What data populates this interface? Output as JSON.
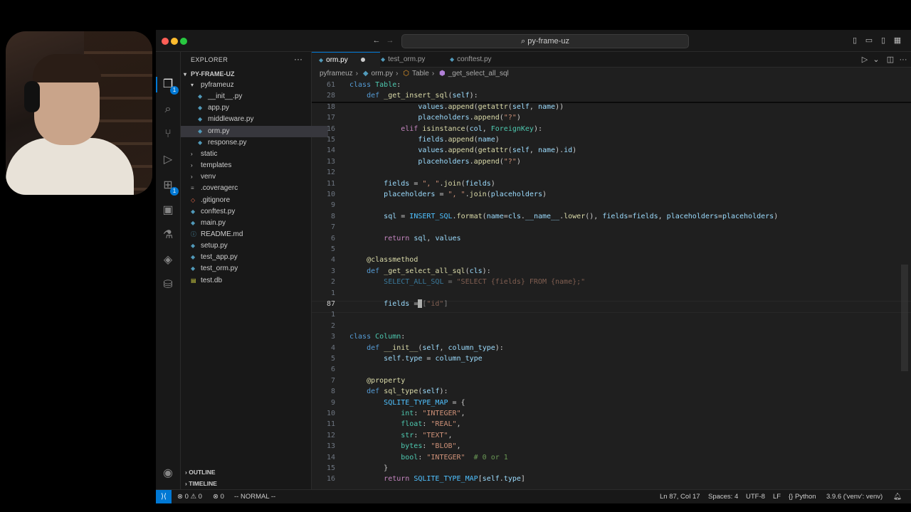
{
  "window": {
    "title": "py-frame-uz"
  },
  "sidebar": {
    "title": "EXPLORER",
    "root": "PY-FRAME-UZ",
    "items": [
      {
        "label": "pyframeuz",
        "kind": "folder-open",
        "depth": 1
      },
      {
        "label": "__init__.py",
        "kind": "py",
        "depth": 2
      },
      {
        "label": "app.py",
        "kind": "py",
        "depth": 2
      },
      {
        "label": "middleware.py",
        "kind": "py",
        "depth": 2
      },
      {
        "label": "orm.py",
        "kind": "py",
        "depth": 2,
        "selected": true
      },
      {
        "label": "response.py",
        "kind": "py",
        "depth": 2
      },
      {
        "label": "static",
        "kind": "folder",
        "depth": 1
      },
      {
        "label": "templates",
        "kind": "folder",
        "depth": 1
      },
      {
        "label": "venv",
        "kind": "folder",
        "depth": 1
      },
      {
        "label": ".coveragerc",
        "kind": "file",
        "depth": 1
      },
      {
        "label": ".gitignore",
        "kind": "git",
        "depth": 1
      },
      {
        "label": "conftest.py",
        "kind": "py",
        "depth": 1
      },
      {
        "label": "main.py",
        "kind": "py",
        "depth": 1
      },
      {
        "label": "README.md",
        "kind": "md",
        "depth": 1
      },
      {
        "label": "setup.py",
        "kind": "py",
        "depth": 1
      },
      {
        "label": "test_app.py",
        "kind": "py",
        "depth": 1
      },
      {
        "label": "test_orm.py",
        "kind": "py",
        "depth": 1
      },
      {
        "label": "test.db",
        "kind": "db",
        "depth": 1
      }
    ],
    "outline": "OUTLINE",
    "timeline": "TIMELINE"
  },
  "tabs": [
    {
      "label": "orm.py",
      "active": true,
      "dirty": true
    },
    {
      "label": "test_orm.py",
      "active": false
    },
    {
      "label": "conftest.py",
      "active": false
    }
  ],
  "breadcrumb": [
    "pyframeuz",
    "orm.py",
    "Table",
    "_get_select_all_sql"
  ],
  "editor": {
    "lines": [
      {
        "n": "61",
        "html": "<span class='kw'>class</span> <span class='cls'>Table</span>:"
      },
      {
        "n": "28",
        "html": "    <span class='kw'>def</span> <span class='fn'>_get_insert_sql</span>(<span class='var'>self</span>):"
      },
      {
        "n": "18",
        "html": "                <span class='var'>values</span>.<span class='fn'>append</span>(<span class='fn'>getattr</span>(<span class='var'>self</span>, <span class='var'>name</span>))"
      },
      {
        "n": "17",
        "html": "                <span class='var'>placeholders</span>.<span class='fn'>append</span>(<span class='str'>\"?\"</span>)"
      },
      {
        "n": "16",
        "html": "            <span class='kw2'>elif</span> <span class='fn'>isinstance</span>(<span class='var'>col</span>, <span class='cls'>ForeignKey</span>):"
      },
      {
        "n": "15",
        "html": "                <span class='var'>fields</span>.<span class='fn'>append</span>(<span class='var'>name</span>)"
      },
      {
        "n": "14",
        "html": "                <span class='var'>values</span>.<span class='fn'>append</span>(<span class='fn'>getattr</span>(<span class='var'>self</span>, <span class='var'>name</span>).<span class='var'>id</span>)"
      },
      {
        "n": "13",
        "html": "                <span class='var'>placeholders</span>.<span class='fn'>append</span>(<span class='str'>\"?\"</span>)"
      },
      {
        "n": "12",
        "html": ""
      },
      {
        "n": "11",
        "html": "        <span class='var'>fields</span> = <span class='str'>\", \"</span>.<span class='fn'>join</span>(<span class='var'>fields</span>)"
      },
      {
        "n": "10",
        "html": "        <span class='var'>placeholders</span> = <span class='str'>\", \"</span>.<span class='fn'>join</span>(<span class='var'>placeholders</span>)"
      },
      {
        "n": "9",
        "html": ""
      },
      {
        "n": "8",
        "html": "        <span class='var'>sql</span> = <span class='const'>INSERT_SQL</span>.<span class='fn'>format</span>(<span class='var'>name</span>=<span class='var'>cls</span>.<span class='var'>__name__</span>.<span class='fn'>lower</span>(), <span class='var'>fields</span>=<span class='var'>fields</span>, <span class='var'>placeholders</span>=<span class='var'>placeholders</span>)"
      },
      {
        "n": "7",
        "html": ""
      },
      {
        "n": "6",
        "html": "        <span class='kw2'>return</span> <span class='var'>sql</span>, <span class='var'>values</span>"
      },
      {
        "n": "5",
        "html": ""
      },
      {
        "n": "4",
        "html": "    <span class='fn'>@classmethod</span>"
      },
      {
        "n": "3",
        "html": "    <span class='kw'>def</span> <span class='fn'>_get_select_all_sql</span>(<span class='var'>cls</span>):"
      },
      {
        "n": "2",
        "html": "        <span class='dim'><span class='const'>SELECT_ALL_SQL</span> = <span class='str'>\"SELECT {fields} FROM {name};\"</span></span>"
      },
      {
        "n": "1",
        "html": ""
      },
      {
        "n": "87",
        "html": "        <span class='var'>fields</span> =<span class='cursor'></span><span class='dim'>[<span class='str'>\"id\"</span>]</span>",
        "current": true
      },
      {
        "n": "1",
        "html": ""
      },
      {
        "n": "2",
        "html": ""
      },
      {
        "n": "3",
        "html": "<span class='kw'>class</span> <span class='cls'>Column</span>:"
      },
      {
        "n": "4",
        "html": "    <span class='kw'>def</span> <span class='fn'>__init__</span>(<span class='var'>self</span>, <span class='var'>column_type</span>):"
      },
      {
        "n": "5",
        "html": "        <span class='var'>self</span>.<span class='var'>type</span> = <span class='var'>column_type</span>"
      },
      {
        "n": "6",
        "html": ""
      },
      {
        "n": "7",
        "html": "    <span class='fn'>@property</span>"
      },
      {
        "n": "8",
        "html": "    <span class='kw'>def</span> <span class='fn'>sql_type</span>(<span class='var'>self</span>):"
      },
      {
        "n": "9",
        "html": "        <span class='const'>SQLITE_TYPE_MAP</span> = {"
      },
      {
        "n": "10",
        "html": "            <span class='cls'>int</span>: <span class='str'>\"INTEGER\"</span>,"
      },
      {
        "n": "11",
        "html": "            <span class='cls'>float</span>: <span class='str'>\"REAL\"</span>,"
      },
      {
        "n": "12",
        "html": "            <span class='cls'>str</span>: <span class='str'>\"TEXT\"</span>,"
      },
      {
        "n": "13",
        "html": "            <span class='cls'>bytes</span>: <span class='str'>\"BLOB\"</span>,"
      },
      {
        "n": "14",
        "html": "            <span class='cls'>bool</span>: <span class='str'>\"INTEGER\"</span>  <span class='cm'># 0 or 1</span>"
      },
      {
        "n": "15",
        "html": "        }"
      },
      {
        "n": "16",
        "html": "        <span class='kw2'>return</span> <span class='const'>SQLITE_TYPE_MAP</span>[<span class='var'>self</span>.<span class='var'>type</span>]"
      }
    ]
  },
  "statusbar": {
    "problems": "⊗ 0 ⚠ 0",
    "ports": "⊗ 0",
    "mode": "-- NORMAL --",
    "position": "Ln 87, Col 17",
    "spaces": "Spaces: 4",
    "encoding": "UTF-8",
    "eol": "LF",
    "language": "{} Python",
    "interpreter": "3.9.6 ('venv': venv)"
  },
  "colors": {
    "accent": "#0078d4",
    "background": "#1f1f1f",
    "sidebar": "#181818"
  }
}
